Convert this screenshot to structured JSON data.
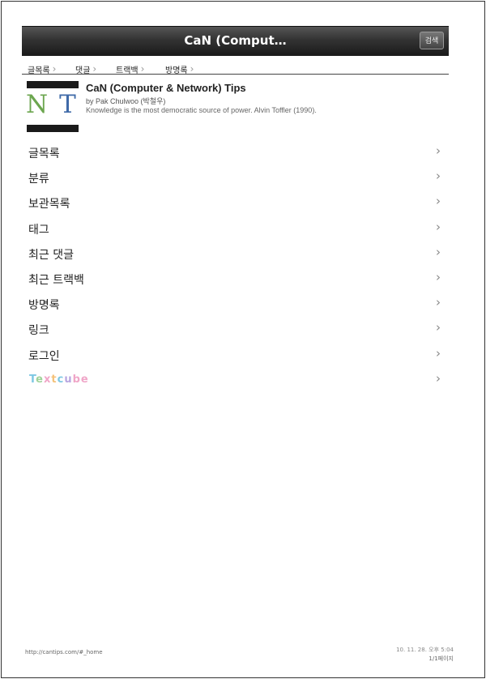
{
  "app": {
    "title": "CaN (Comput…",
    "search_label": "검색"
  },
  "breadcrumb": {
    "items": [
      {
        "label": "글목록"
      },
      {
        "label": "댓글"
      },
      {
        "label": "트랙백"
      },
      {
        "label": "방명록"
      }
    ],
    "arrow": "›"
  },
  "blog": {
    "logo_n": "N",
    "logo_t": "T",
    "title": "CaN (Computer & Network) Tips",
    "author": "by Pak Chulwoo (박철우)",
    "description": "Knowledge is the most democratic source of power. Alvin Toffler (1990)."
  },
  "menu": {
    "chevron": "›",
    "items": [
      {
        "label": "글목록"
      },
      {
        "label": "분류"
      },
      {
        "label": "보관목록"
      },
      {
        "label": "태그"
      },
      {
        "label": "최근 댓글"
      },
      {
        "label": "최근 트랙백"
      },
      {
        "label": "방명록"
      },
      {
        "label": "링크"
      },
      {
        "label": "로그인"
      }
    ],
    "textcube": {
      "letters": [
        "T",
        "e",
        "x",
        "t",
        "c",
        "u",
        "b",
        "e"
      ],
      "colors": [
        "#7ec8e3",
        "#9fd39a",
        "#f0a6c8",
        "#f4c27a",
        "#7ec8e3",
        "#b8a6e0",
        "#f0a6c8",
        "#f0a6c8"
      ]
    }
  },
  "footer": {
    "url": "http://cantips.com/#_home",
    "datetime": "10. 11. 28. 오후 5:04",
    "page": "1/1페이지"
  },
  "colors": {
    "titlebar": "#333333",
    "logo_n": "#6ca64f",
    "logo_t": "#3f6aa8",
    "chevron": "#888888"
  }
}
